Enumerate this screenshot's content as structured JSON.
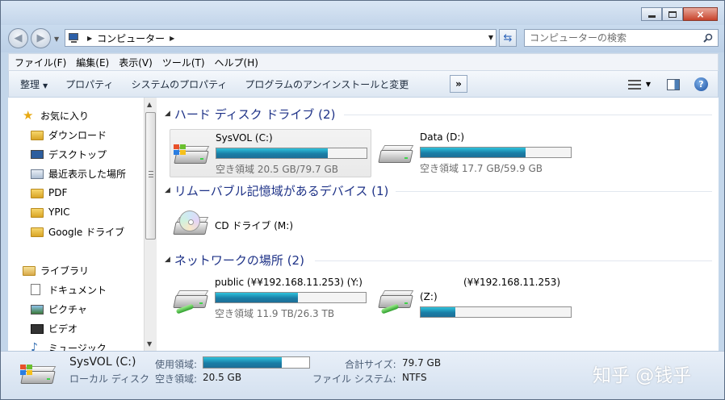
{
  "window": {
    "buttons": {
      "minimize": "minimize",
      "maximize": "maximize",
      "close": "×"
    }
  },
  "address": {
    "breadcrumb": [
      "コンピューター"
    ],
    "search_placeholder": "コンピューターの検索"
  },
  "menu": [
    "ファイル(F)",
    "編集(E)",
    "表示(V)",
    "ツール(T)",
    "ヘルプ(H)"
  ],
  "toolbar": {
    "organize": "整理",
    "buttons": [
      "プロパティ",
      "システムのプロパティ",
      "プログラムのアンインストールと変更"
    ],
    "more": "»"
  },
  "sidebar": {
    "favorites_label": "お気に入り",
    "favorites": [
      "ダウンロード",
      "デスクトップ",
      "最近表示した場所",
      "PDF",
      "YPIC",
      "Google ドライブ"
    ],
    "libraries_label": "ライブラリ",
    "libraries": [
      "ドキュメント",
      "ピクチャ",
      "ビデオ",
      "ミュージック"
    ]
  },
  "groups": {
    "hdd": {
      "title": "ハード ディスク ドライブ (2)",
      "drives": [
        {
          "name": "SysVOL (C:)",
          "free": "空き領域 20.5 GB/79.7 GB",
          "used_fraction": 0.74
        },
        {
          "name": "Data (D:)",
          "free": "空き領域 17.7 GB/59.9 GB",
          "used_fraction": 0.7
        }
      ]
    },
    "removable": {
      "title": "リムーバブル記憶域があるデバイス (1)",
      "drives": [
        {
          "name": "CD ドライブ (M:)"
        }
      ]
    },
    "network": {
      "title": "ネットワークの場所 (2)",
      "drives": [
        {
          "name": "public (¥¥192.168.11.253) (Y:)",
          "free": "空き領域 11.9 TB/26.3 TB",
          "used_fraction": 0.55
        },
        {
          "name": "(¥¥192.168.11.253)",
          "letter": "(Z:)",
          "used_fraction": 0.23
        }
      ]
    }
  },
  "details": {
    "name": "SysVOL (C:)",
    "type": "ローカル ディスク",
    "used_label": "使用領域:",
    "used_fraction": 0.74,
    "free_label": "空き領域:",
    "free_value": "20.5 GB",
    "total_label": "合計サイズ:",
    "total_value": "79.7 GB",
    "fs_label": "ファイル システム:",
    "fs_value": "NTFS"
  },
  "watermark": "知乎 @钱乎"
}
